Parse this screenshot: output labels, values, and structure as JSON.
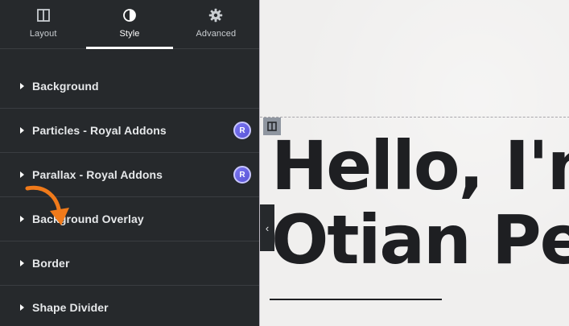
{
  "tabs": [
    {
      "label": "Layout",
      "icon": "layout-columns-icon",
      "active": false
    },
    {
      "label": "Style",
      "icon": "half-circle-contrast-icon",
      "active": true
    },
    {
      "label": "Advanced",
      "icon": "gear-icon",
      "active": false
    }
  ],
  "sections": [
    {
      "label": "Background"
    },
    {
      "label": "Particles - Royal Addons",
      "badge": "R"
    },
    {
      "label": "Parallax - Royal Addons",
      "badge": "R"
    },
    {
      "label": "Background Overlay"
    },
    {
      "label": "Border"
    },
    {
      "label": "Shape Divider"
    }
  ],
  "canvas": {
    "headline_line1": "Hello, I'm",
    "headline_line2": "Otian Pe",
    "collapse_glyph": "‹"
  },
  "colors": {
    "panel_bg": "#26292c",
    "badge_accent": "#6c67e6",
    "annotation_arrow": "#f07a1a",
    "headline": "#1e1f22"
  }
}
